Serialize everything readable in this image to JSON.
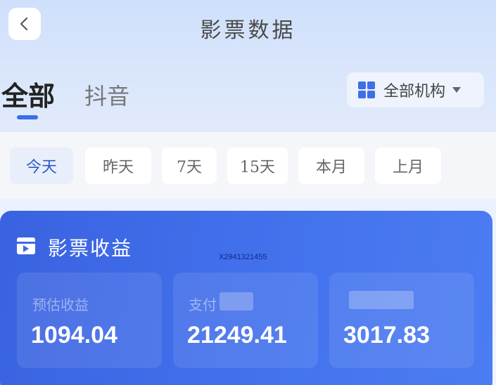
{
  "header": {
    "title": "影票数据",
    "back_icon": "chevron-left-icon"
  },
  "tabs": [
    {
      "label": "全部",
      "active": true
    },
    {
      "label": "抖音",
      "active": false
    }
  ],
  "org_select": {
    "label": "全部机构",
    "icon": "grid-icon"
  },
  "date_filters": [
    {
      "label": "今天",
      "active": true
    },
    {
      "label": "昨天",
      "active": false
    },
    {
      "label": "7天",
      "active": false
    },
    {
      "label": "15天",
      "active": false
    },
    {
      "label": "本月",
      "active": false
    },
    {
      "label": "上月",
      "active": false
    }
  ],
  "card": {
    "title": "影票收益",
    "icon": "film-icon",
    "watermark": "X2941321455",
    "metrics": [
      {
        "label": "预估收益",
        "value": "1094.04"
      },
      {
        "label": "支付",
        "value": "21249.41"
      },
      {
        "label": "",
        "value": "3017.83"
      }
    ]
  },
  "colors": {
    "accent": "#3b6ee8",
    "card_bg": "#4473ee"
  }
}
